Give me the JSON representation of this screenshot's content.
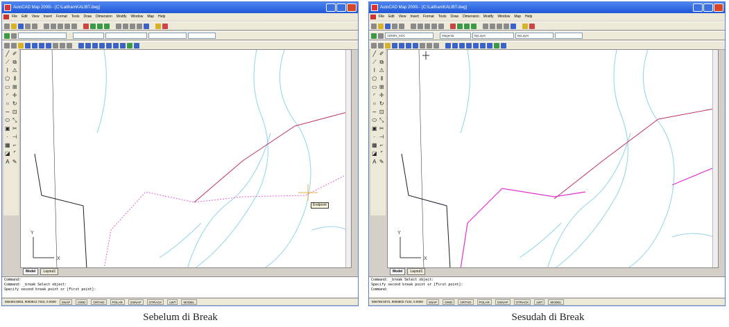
{
  "before": {
    "title": "AutoCAD Map 2000i - [C:\\Latihan\\KALIBT.dwg]",
    "menu": [
      "File",
      "Edit",
      "View",
      "Insert",
      "Format",
      "Tools",
      "Draw",
      "Dimension",
      "Modify",
      "Window",
      "Map",
      "Help"
    ],
    "layer_combo": "",
    "color_combo": "",
    "linetype_combo": "",
    "lineweight_combo": "",
    "tabs": [
      "Model",
      "Layout1"
    ],
    "tooltip": "Endpoint",
    "command_lines": [
      "Command:",
      "Command: _break Select object:",
      "Specify second break point or [First point]:"
    ],
    "coords": "556483.8053, 9093812.7316, 0.0000",
    "status_buttons": [
      "SNAP",
      "GRID",
      "ORTHO",
      "POLAR",
      "OSNAP",
      "OTRACK",
      "LWT",
      "MODEL"
    ],
    "caption": "Sebelum di Break"
  },
  "after": {
    "title": "AutoCAD Map 2000i - [C:\\Latihan\\KALIBT.dwg]",
    "menu": [
      "File",
      "Edit",
      "View",
      "Insert",
      "Format",
      "Tools",
      "Draw",
      "Dimension",
      "Modify",
      "Window",
      "Map",
      "Help"
    ],
    "layer_combo": "ADMIN_KEC",
    "color_combo": "Magenta",
    "linetype_combo": "ByLayer",
    "lineweight_combo": "ByLayer",
    "tabs": [
      "Model",
      "Layout1"
    ],
    "command_lines": [
      "Command: _break Select object:",
      "Specify second break point or [First point]:",
      "Command:"
    ],
    "coords": "556769.5072, 9093802.7134, 0.0000",
    "status_buttons": [
      "SNAP",
      "GRID",
      "ORTHO",
      "POLAR",
      "OSNAP",
      "OTRACK",
      "LWT",
      "MODEL"
    ],
    "caption": "Sesudah di Break"
  },
  "colors": {
    "contour": "#8fd3e8",
    "road": "#c0306a",
    "boundary": "#1a1a2a",
    "dotted": "#e060d0",
    "magenta": "#e030d0"
  },
  "icons": [
    "line-icon",
    "polyline-icon",
    "rectangle-icon",
    "circle-icon",
    "arc-icon",
    "hatch-icon",
    "text-icon",
    "erase-icon",
    "copy-icon",
    "mirror-icon",
    "offset-icon",
    "move-icon",
    "rotate-icon",
    "trim-icon",
    "break-icon",
    "fillet-icon"
  ]
}
